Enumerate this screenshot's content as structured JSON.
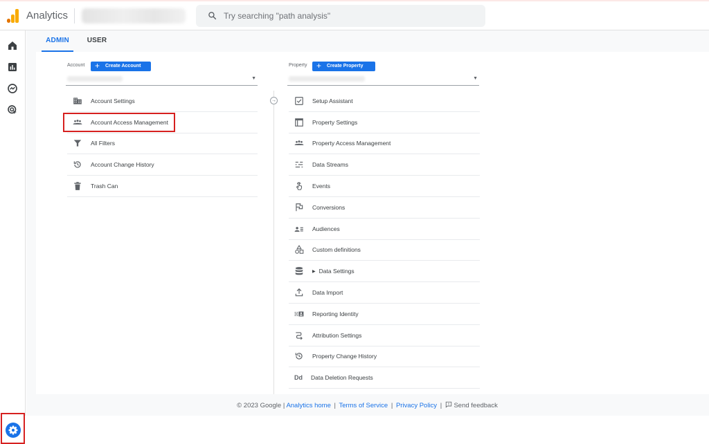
{
  "app": {
    "title": "Analytics"
  },
  "search": {
    "placeholder": "Try searching \"path analysis\""
  },
  "tabs": [
    {
      "label": "ADMIN",
      "active": true
    },
    {
      "label": "USER",
      "active": false
    }
  ],
  "account": {
    "label": "Account",
    "create_button": "Create Account",
    "items": [
      {
        "label": "Account Settings",
        "icon": "building-icon"
      },
      {
        "label": "Account Access Management",
        "icon": "people-icon"
      },
      {
        "label": "All Filters",
        "icon": "filter-icon"
      },
      {
        "label": "Account Change History",
        "icon": "history-icon"
      },
      {
        "label": "Trash Can",
        "icon": "trash-icon"
      }
    ]
  },
  "property": {
    "label": "Property",
    "create_button": "Create Property",
    "items": [
      {
        "label": "Setup Assistant",
        "icon": "checkbox-icon"
      },
      {
        "label": "Property Settings",
        "icon": "window-icon"
      },
      {
        "label": "Property Access Management",
        "icon": "people-icon"
      },
      {
        "label": "Data Streams",
        "icon": "streams-icon"
      },
      {
        "label": "Events",
        "icon": "touch-icon"
      },
      {
        "label": "Conversions",
        "icon": "flag-icon"
      },
      {
        "label": "Audiences",
        "icon": "audience-icon"
      },
      {
        "label": "Custom definitions",
        "icon": "shapes-icon"
      },
      {
        "label": "Data Settings",
        "icon": "database-icon"
      },
      {
        "label": "Data Import",
        "icon": "upload-icon"
      },
      {
        "label": "Reporting Identity",
        "icon": "identity-icon"
      },
      {
        "label": "Attribution Settings",
        "icon": "attribution-icon"
      },
      {
        "label": "Property Change History",
        "icon": "history-icon"
      },
      {
        "label": "Data Deletion Requests",
        "icon": "dd-icon"
      }
    ]
  },
  "footer": {
    "copyright": "© 2023 Google |",
    "analytics_home": "Analytics home",
    "sep1": "|",
    "terms": "Terms of Service",
    "sep2": "|",
    "privacy": "Privacy Policy",
    "sep3": "|",
    "feedback": "Send feedback"
  },
  "colors": {
    "accent": "#1a73e8",
    "highlight_border": "#d6201f",
    "logo_orange": "#f9ab00",
    "logo_dark_orange": "#e37400"
  }
}
